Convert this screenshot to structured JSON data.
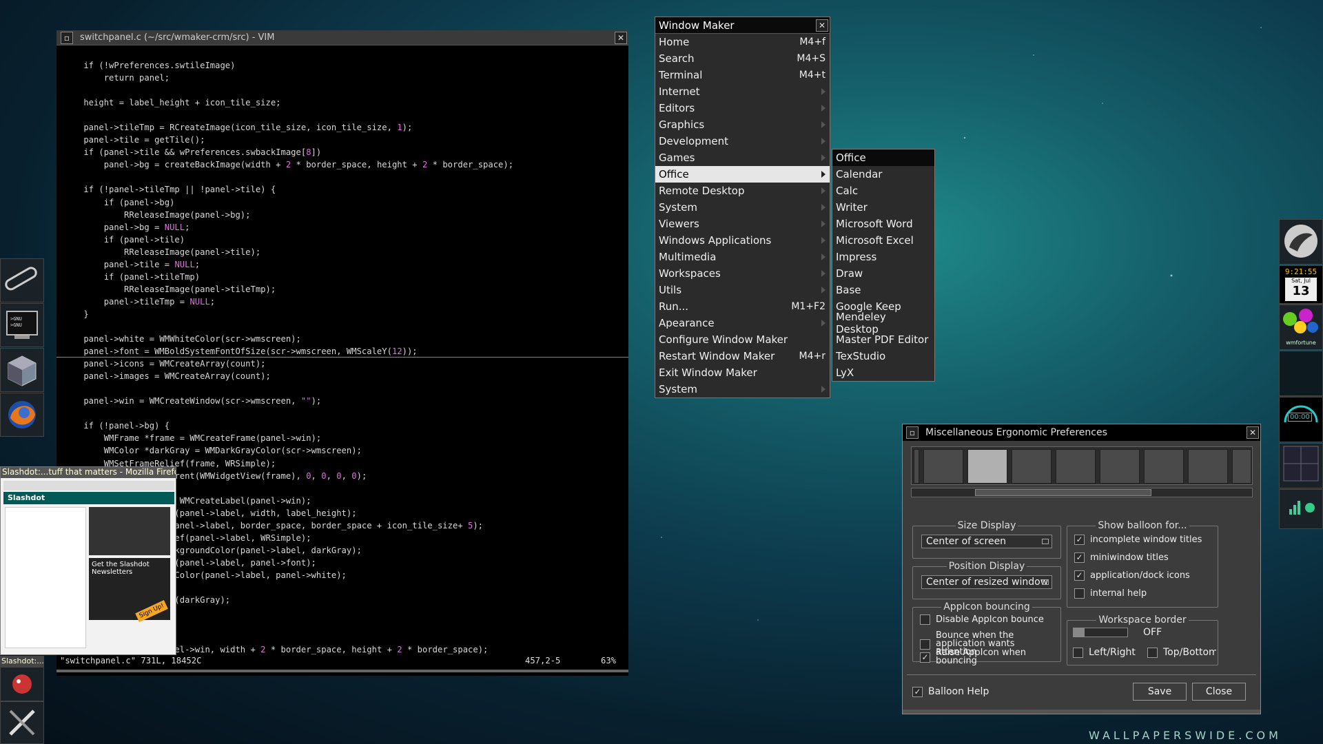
{
  "vim": {
    "title": "switchpanel.c (~/src/wmaker-crm/src) - VIM",
    "close_label": "✕",
    "status_file": "\"switchpanel.c\" 731L, 18452C",
    "status_pos": "457,2-5",
    "status_pct": "63%"
  },
  "firefox": {
    "title": "Slashdot:...tuff that matters - Mozilla Firefox",
    "dock_label": "Slashdot:...",
    "site": "Slashdot",
    "headline": "Get the Slashdot Newsletters",
    "cta": "Sign Up!"
  },
  "menu": {
    "title": "Window Maker",
    "close": "✕",
    "items": [
      {
        "label": "Home",
        "shortcut": "M4+f"
      },
      {
        "label": "Search",
        "shortcut": "M4+S"
      },
      {
        "label": "Terminal",
        "shortcut": "M4+t"
      },
      {
        "label": "Internet",
        "shortcut": ""
      },
      {
        "label": "Editors",
        "shortcut": ""
      },
      {
        "label": "Graphics",
        "shortcut": ""
      },
      {
        "label": "Development",
        "shortcut": ""
      },
      {
        "label": "Games",
        "shortcut": ""
      },
      {
        "label": "Office",
        "shortcut": ""
      },
      {
        "label": "Remote Desktop",
        "shortcut": ""
      },
      {
        "label": "System",
        "shortcut": ""
      },
      {
        "label": "Viewers",
        "shortcut": ""
      },
      {
        "label": "Windows Applications",
        "shortcut": ""
      },
      {
        "label": "Multimedia",
        "shortcut": ""
      },
      {
        "label": "Workspaces",
        "shortcut": ""
      },
      {
        "label": "Utils",
        "shortcut": ""
      },
      {
        "label": "Run...",
        "shortcut": "M1+F2"
      },
      {
        "label": "Apearance",
        "shortcut": ""
      },
      {
        "label": "Configure Window Maker",
        "shortcut": ""
      },
      {
        "label": "Restart Window Maker",
        "shortcut": "M4+r"
      },
      {
        "label": "Exit Window Maker",
        "shortcut": ""
      },
      {
        "label": "System",
        "shortcut": ""
      }
    ]
  },
  "submenu": {
    "title": "Office",
    "items": [
      "Calendar",
      "Calc",
      "Writer",
      "Microsoft Word",
      "Microsoft Excel",
      "Impress",
      "Draw",
      "Base",
      "Google Keep",
      "Mendeley Desktop",
      "Master PDF Editor",
      "TexStudio",
      "LyX"
    ]
  },
  "prefs": {
    "title": "Miscellaneous Ergonomic Preferences",
    "size_display": {
      "legend": "Size Display",
      "value": "Center of screen"
    },
    "position_display": {
      "legend": "Position Display",
      "value": "Center of resized window"
    },
    "appicon": {
      "legend": "AppIcon bouncing",
      "options": [
        {
          "label": "Disable AppIcon bounce",
          "checked": false
        },
        {
          "label": "Bounce when the application wants attention",
          "checked": false
        },
        {
          "label": "Raise AppIcon when bouncing",
          "checked": true
        }
      ]
    },
    "balloon": {
      "legend": "Show balloon for...",
      "options": [
        {
          "label": "incomplete window titles",
          "checked": true
        },
        {
          "label": "miniwindow titles",
          "checked": true
        },
        {
          "label": "application/dock icons",
          "checked": true
        },
        {
          "label": "internal help",
          "checked": false
        }
      ]
    },
    "workspace_border": {
      "legend": "Workspace border",
      "value": "OFF",
      "left_right": "Left/Right",
      "top_bottom": "Top/Bottom"
    },
    "balloon_help": "Balloon Help",
    "save": "Save",
    "close": "Close",
    "check_mark": "✓"
  },
  "dock": {
    "clock_time": "9:21:55",
    "date_day": "Sat, Jul",
    "date_num": "13",
    "timer": "00:00",
    "wmfortune": "wmfortune"
  },
  "watermark": "WALLPAPERSWIDE.COM"
}
